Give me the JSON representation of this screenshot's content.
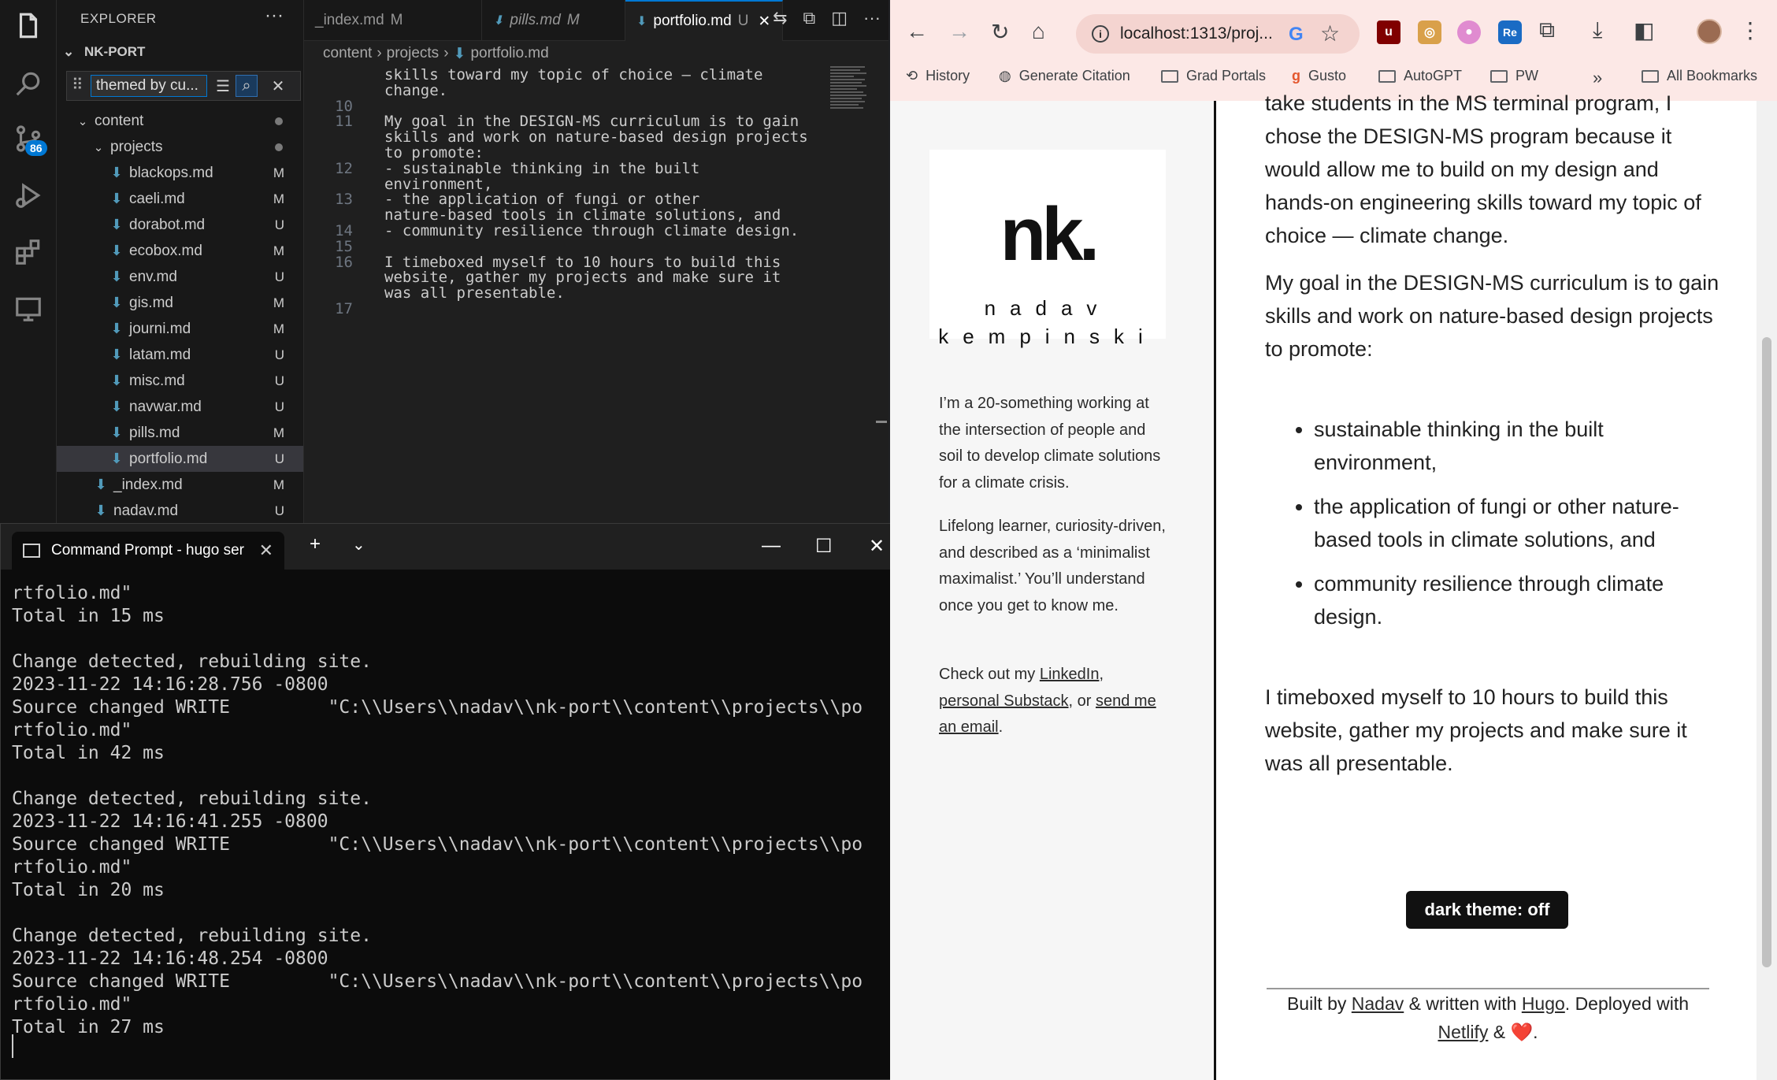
{
  "vscode": {
    "explorer_title": "EXPLORER",
    "more": "···",
    "root": "NK-PORT",
    "filter_text": "themed by cu...",
    "source_control_badge": "86",
    "tree": [
      {
        "label": "content",
        "indent": 0,
        "kind": "folder",
        "status": "dot"
      },
      {
        "label": "projects",
        "indent": 1,
        "kind": "folder",
        "status": "dot"
      },
      {
        "label": "blackops.md",
        "indent": 2,
        "kind": "file",
        "status": "M"
      },
      {
        "label": "caeli.md",
        "indent": 2,
        "kind": "file",
        "status": "M"
      },
      {
        "label": "dorabot.md",
        "indent": 2,
        "kind": "file",
        "status": "U"
      },
      {
        "label": "ecobox.md",
        "indent": 2,
        "kind": "file",
        "status": "M"
      },
      {
        "label": "env.md",
        "indent": 2,
        "kind": "file",
        "status": "U"
      },
      {
        "label": "gis.md",
        "indent": 2,
        "kind": "file",
        "status": "M"
      },
      {
        "label": "journi.md",
        "indent": 2,
        "kind": "file",
        "status": "M"
      },
      {
        "label": "latam.md",
        "indent": 2,
        "kind": "file",
        "status": "U"
      },
      {
        "label": "misc.md",
        "indent": 2,
        "kind": "file",
        "status": "U"
      },
      {
        "label": "navwar.md",
        "indent": 2,
        "kind": "file",
        "status": "U"
      },
      {
        "label": "pills.md",
        "indent": 2,
        "kind": "file",
        "status": "M"
      },
      {
        "label": "portfolio.md",
        "indent": 2,
        "kind": "file",
        "status": "U",
        "selected": true
      },
      {
        "label": "_index.md",
        "indent": 1,
        "kind": "file",
        "status": "M"
      },
      {
        "label": "nadav.md",
        "indent": 1,
        "kind": "file",
        "status": "U"
      }
    ],
    "tabs": [
      {
        "label": "_index.md",
        "mark": "M",
        "active": false
      },
      {
        "label": "pills.md",
        "mark": "M",
        "active": false
      },
      {
        "label": "portfolio.md",
        "mark": "U",
        "active": true
      }
    ],
    "breadcrumb": [
      "content",
      "projects",
      "portfolio.md"
    ],
    "code": [
      {
        "ln": "",
        "text": "skills toward my topic of choice — climate"
      },
      {
        "ln": "",
        "text": "change."
      },
      {
        "ln": "10",
        "text": ""
      },
      {
        "ln": "11",
        "text": "My goal in the DESIGN-MS curriculum is to gain"
      },
      {
        "ln": "",
        "text": "skills and work on nature-based design projects"
      },
      {
        "ln": "",
        "text": "to promote:"
      },
      {
        "ln": "12",
        "text": "- sustainable thinking in the built"
      },
      {
        "ln": "",
        "text": "environment,"
      },
      {
        "ln": "13",
        "text": "- the application of fungi or other"
      },
      {
        "ln": "",
        "text": "nature-based tools in climate solutions, and"
      },
      {
        "ln": "14",
        "text": "- community resilience through climate design."
      },
      {
        "ln": "15",
        "text": ""
      },
      {
        "ln": "16",
        "text": "I timeboxed myself to 10 hours to build this"
      },
      {
        "ln": "",
        "text": "website, gather my projects and make sure it"
      },
      {
        "ln": "",
        "text": "was all presentable."
      },
      {
        "ln": "17",
        "text": ""
      }
    ]
  },
  "cmd": {
    "tab_title": "Command Prompt - hugo  ser",
    "lines": [
      "rtfolio.md\"",
      "Total in 15 ms",
      "",
      "Change detected, rebuilding site.",
      "2023-11-22 14:16:28.756 -0800",
      "Source changed WRITE         \"C:\\\\Users\\\\nadav\\\\nk-port\\\\content\\\\projects\\\\po",
      "rtfolio.md\"",
      "Total in 42 ms",
      "",
      "Change detected, rebuilding site.",
      "2023-11-22 14:16:41.255 -0800",
      "Source changed WRITE         \"C:\\\\Users\\\\nadav\\\\nk-port\\\\content\\\\projects\\\\po",
      "rtfolio.md\"",
      "Total in 20 ms",
      "",
      "Change detected, rebuilding site.",
      "2023-11-22 14:16:48.254 -0800",
      "Source changed WRITE         \"C:\\\\Users\\\\nadav\\\\nk-port\\\\content\\\\projects\\\\po",
      "rtfolio.md\"",
      "Total in 27 ms"
    ]
  },
  "chrome": {
    "url": "localhost:1313/proj...",
    "bookmarks": [
      "History",
      "Generate Citation",
      "Grad Portals",
      "Gusto",
      "AutoGPT",
      "PW",
      "All Bookmarks"
    ],
    "bookmarks_more": "»",
    "logo": {
      "mark": "nk.",
      "first": "nadav",
      "last": "kempinski"
    },
    "bio": [
      "I’m a 20-something working at the intersection of people and soil to develop climate solutions for a climate crisis.",
      "Lifelong learner, curiosity-driven, and described as a ‘minimalist maximalist.’ You’ll understand once you get to know me."
    ],
    "links_intro": "Check out my ",
    "link_linkedin": "LinkedIn",
    "link_sep1": ",",
    "link_substack": "personal Substack",
    "link_sep2": ", or ",
    "link_email": "send me an email",
    "link_end": ".",
    "article": {
      "p1": "take students in the MS terminal program, I chose the DESIGN-MS program because it would allow me to build on my design and hands-on engineering skills toward my topic of choice — climate change.",
      "p2": "My goal in the DESIGN-MS curriculum is to gain skills and work on nature-based design projects to promote:",
      "bullets": [
        "sustainable thinking in the built environment,",
        "the application of fungi or other nature-based tools in climate solutions, and",
        "community resilience through climate design."
      ],
      "p3": "I timeboxed myself to 10 hours to build this website, gather my projects and make sure it was all presentable."
    },
    "theme_button": "dark theme: off",
    "footer": {
      "built_by": "Built by ",
      "author": "Nadav",
      "written_with": " & written with ",
      "hugo": "Hugo",
      "deployed": ". Deployed with ",
      "netlify": "Netlify",
      "amp": " & ",
      "heart": "❤️",
      "end": "."
    }
  }
}
